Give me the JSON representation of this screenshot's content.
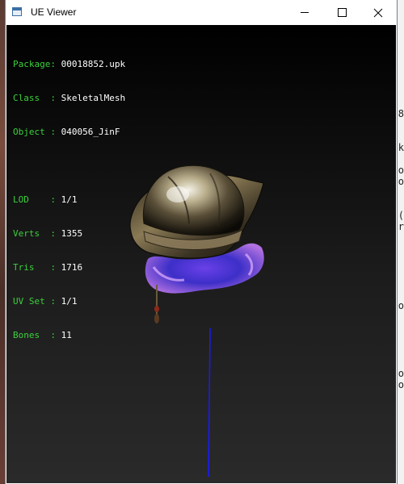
{
  "window": {
    "title": "UE Viewer",
    "icon": "app-window-icon"
  },
  "titlebar_buttons": {
    "minimize_icon": "minimize-icon",
    "maximize_icon": "maximize-icon",
    "close_icon": "close-icon"
  },
  "info": {
    "object_block": [
      {
        "label": "Package:",
        "value": "00018852.upk"
      },
      {
        "label": "Class  :",
        "value": "SkeletalMesh"
      },
      {
        "label": "Object :",
        "value": "040056_JinF"
      }
    ],
    "mesh_block": [
      {
        "label": "LOD    :",
        "value": "1/1"
      },
      {
        "label": "Verts  :",
        "value": "1355"
      },
      {
        "label": "Tris   :",
        "value": "1716"
      },
      {
        "label": "UV Set :",
        "value": "1/1"
      },
      {
        "label": "Bones  :",
        "value": "11"
      }
    ]
  },
  "colors": {
    "label_green": "#3cd03c",
    "value_white": "#ffffff",
    "viewport_dark": "#000000",
    "bone_line_blue": "#1a1aff"
  },
  "background_right_glyphs": [
    "8",
    "k",
    "o",
    "o",
    "(",
    "r",
    "o",
    "o",
    "o"
  ]
}
